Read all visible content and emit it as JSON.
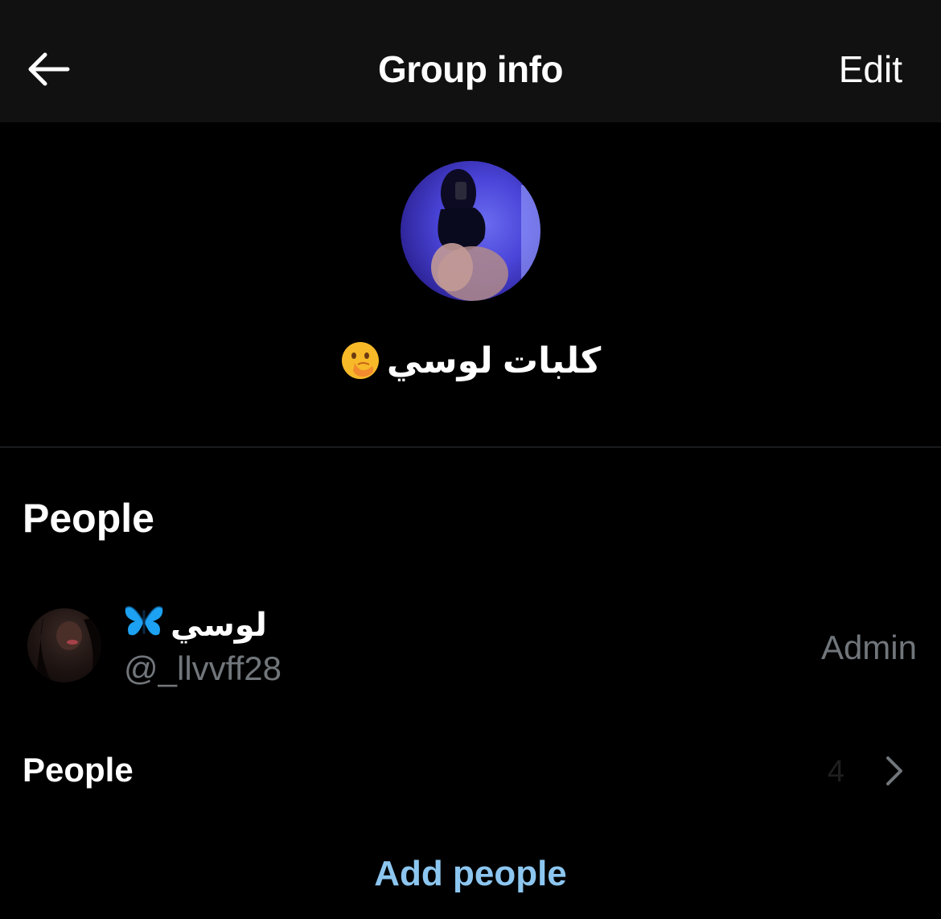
{
  "header": {
    "title": "Group info",
    "edit_label": "Edit",
    "back_icon": "arrow-left-icon"
  },
  "group": {
    "name": "كلبات لوسي",
    "name_emoji": "face-with-hand-over-mouth-icon"
  },
  "people_section": {
    "title": "People",
    "members": [
      {
        "name": "لوسي",
        "name_emoji": "blue-butterfly-icon",
        "handle": "@_llvvff28",
        "role": "Admin"
      }
    ],
    "people_row_label": "People",
    "people_row_count": "4",
    "add_people_label": "Add people"
  },
  "colors": {
    "background": "#000000",
    "header_bg": "#111111",
    "muted_text": "#71767b",
    "link": "#8cc6f0",
    "divider": "#2f3336"
  }
}
